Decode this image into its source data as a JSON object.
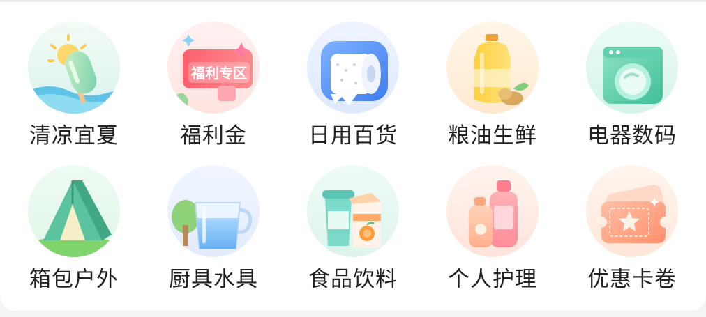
{
  "categories": [
    {
      "label": "清凉宜夏",
      "icon": "popsicle-icon"
    },
    {
      "label": "福利金",
      "icon": "welfare-zone-icon",
      "badge": "福利专区"
    },
    {
      "label": "日用百货",
      "icon": "toilet-paper-icon"
    },
    {
      "label": "粮油生鲜",
      "icon": "cooking-oil-icon"
    },
    {
      "label": "电器数码",
      "icon": "washing-machine-icon"
    },
    {
      "label": "箱包户外",
      "icon": "tent-icon"
    },
    {
      "label": "厨具水具",
      "icon": "water-cup-icon"
    },
    {
      "label": "食品饮料",
      "icon": "drinks-icon"
    },
    {
      "label": "个人护理",
      "icon": "lotion-bottles-icon"
    },
    {
      "label": "优惠卡卷",
      "icon": "coupon-card-icon"
    }
  ]
}
